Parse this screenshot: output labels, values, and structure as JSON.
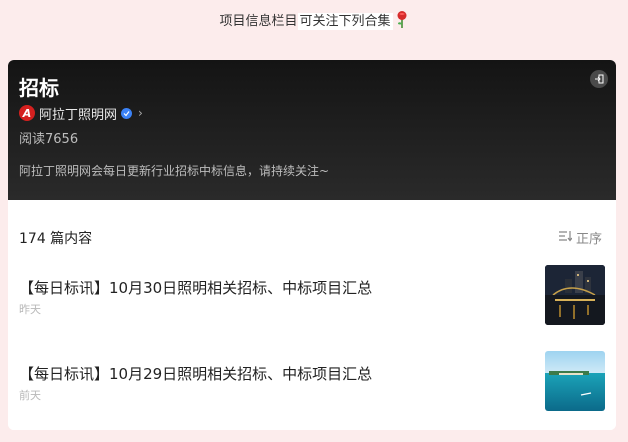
{
  "note": {
    "prefix": "项目信息栏目",
    "highlight": "可关注下列合集"
  },
  "header": {
    "title": "招标",
    "author_name": "阿拉丁照明网",
    "logo_letter": "A",
    "reads": "阅读7656",
    "description": "阿拉丁照明网会每日更新行业招标中标信息，请持续关注~"
  },
  "list": {
    "count_label": "174 篇内容",
    "sort_label": "正序",
    "articles": [
      {
        "title": "【每日标讯】10月30日照明相关招标、中标项目汇总",
        "date": "昨天"
      },
      {
        "title": "【每日标讯】10月29日照明相关招标、中标项目汇总",
        "date": "前天"
      }
    ]
  },
  "colors": {
    "page_bg": "#fcecec",
    "header_bg": "#1a1a1a",
    "brand_red": "#d4201f",
    "verified_blue": "#3b82f6"
  },
  "icons": [
    "rose-icon",
    "exit-icon",
    "brand-logo-icon",
    "verified-icon",
    "chevron-right-icon",
    "sort-icon"
  ]
}
